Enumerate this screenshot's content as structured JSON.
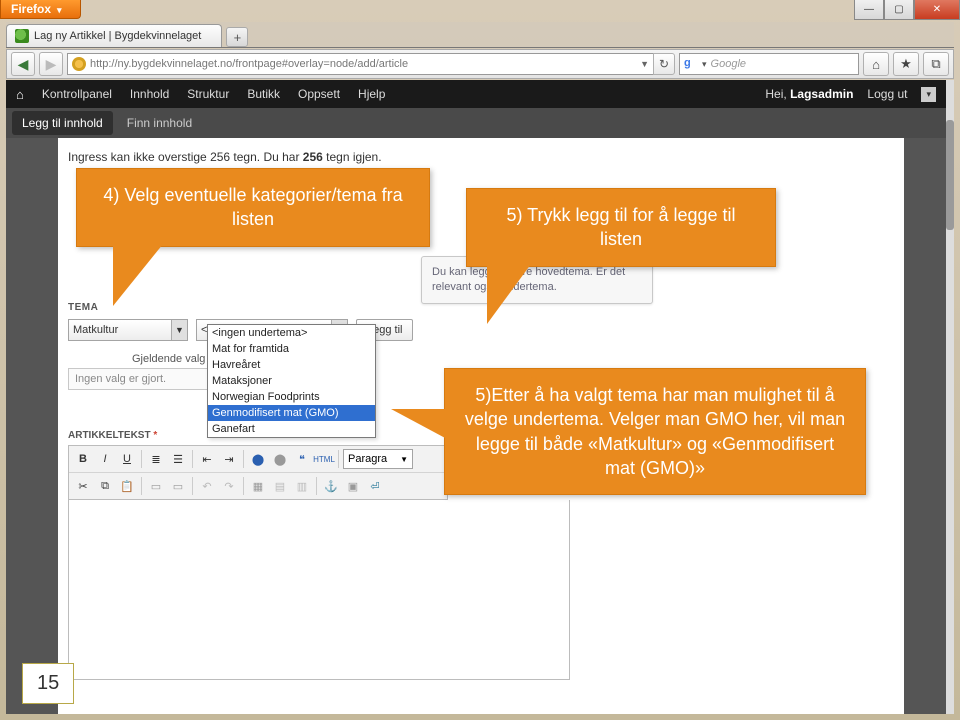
{
  "browser": {
    "name": "Firefox",
    "tab_title": "Lag ny Artikkel | Bygdekvinnelaget",
    "url": "http://ny.bygdekvinnelaget.no/frontpage#overlay=node/add/article",
    "search_placeholder": "Google"
  },
  "adminbar": {
    "items": [
      "Kontrollpanel",
      "Innhold",
      "Struktur",
      "Butikk",
      "Oppsett",
      "Hjelp"
    ],
    "greeting_prefix": "Hei, ",
    "user": "Lagsadmin",
    "logout": "Logg ut",
    "sub_active": "Legg til innhold",
    "sub_link": "Finn innhold"
  },
  "ingress": {
    "prefix": "Ingress kan ikke overstige 256 tegn. Du har ",
    "count": "256",
    "suffix": " tegn igjen."
  },
  "hint": "Du kan legge til flere hovedtema. Er det relevant også undertema.",
  "tema": {
    "label": "TEMA",
    "main_value": "Matkultur",
    "sub_value": "<ingen undertema>",
    "add_button": "Legg til",
    "options": [
      "<ingen undertema>",
      "Mat for framtida",
      "Havreåret",
      "Mataksjoner",
      "Norwegian Foodprints",
      "Genmodifisert mat (GMO)",
      "Ganefart"
    ],
    "highlight_index": 5,
    "current_label": "Gjeldende valg",
    "current_value": "Ingen valg er gjort."
  },
  "article": {
    "label": "ARTIKKELTEKST",
    "required": "*",
    "format": "Paragra"
  },
  "callouts": {
    "c1": "4) Velg eventuelle kategorier/tema fra listen",
    "c2": "5) Trykk legg til for å legge til listen",
    "c3": "5)Etter å ha valgt tema har man mulighet til å velge undertema. Velger man GMO her, vil man legge til både «Matkultur» og «Genmodifisert mat (GMO)»"
  },
  "page_number": "15"
}
